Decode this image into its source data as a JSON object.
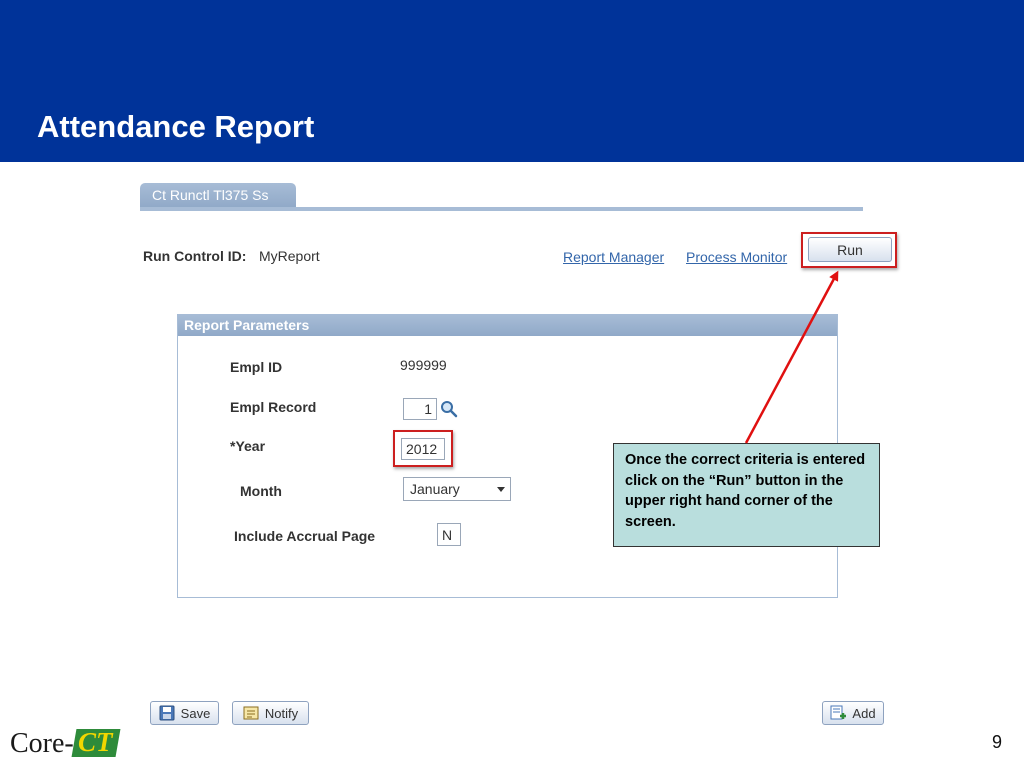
{
  "slide": {
    "title": "Attendance Report",
    "page_number": "9"
  },
  "page_tab": {
    "label": "Ct Runctl Tl375 Ss"
  },
  "run_control": {
    "label": "Run Control ID:",
    "value": "MyReport"
  },
  "links": {
    "report_manager": "Report Manager",
    "process_monitor": "Process Monitor"
  },
  "run_button": {
    "label": "Run"
  },
  "report_parameters": {
    "title": "Report Parameters",
    "empl_id": {
      "label": "Empl ID",
      "value": "999999"
    },
    "empl_record": {
      "label": "Empl Record",
      "value": "1"
    },
    "year": {
      "label": "*Year",
      "value": "2012"
    },
    "month": {
      "label": "Month",
      "value": "January"
    },
    "include_accrual": {
      "label": "Include Accrual Page",
      "value": "N"
    }
  },
  "callout": {
    "text": "Once the correct criteria is entered click on the “Run” button in the upper right hand corner of the screen."
  },
  "toolbar": {
    "save_label": "Save",
    "notify_label": "Notify",
    "add_label": "Add"
  },
  "logo": {
    "core_text": "Core-",
    "ct_text": "CT"
  },
  "colors": {
    "banner": "#003399",
    "highlight": "#cc1f1f",
    "callout_bg": "#b9dedd",
    "group_header": "#a7bcd6",
    "link": "#3366aa"
  },
  "icons": {
    "lookup": "magnifier-icon",
    "save": "save-icon",
    "notify": "notify-icon",
    "add": "add-icon"
  }
}
